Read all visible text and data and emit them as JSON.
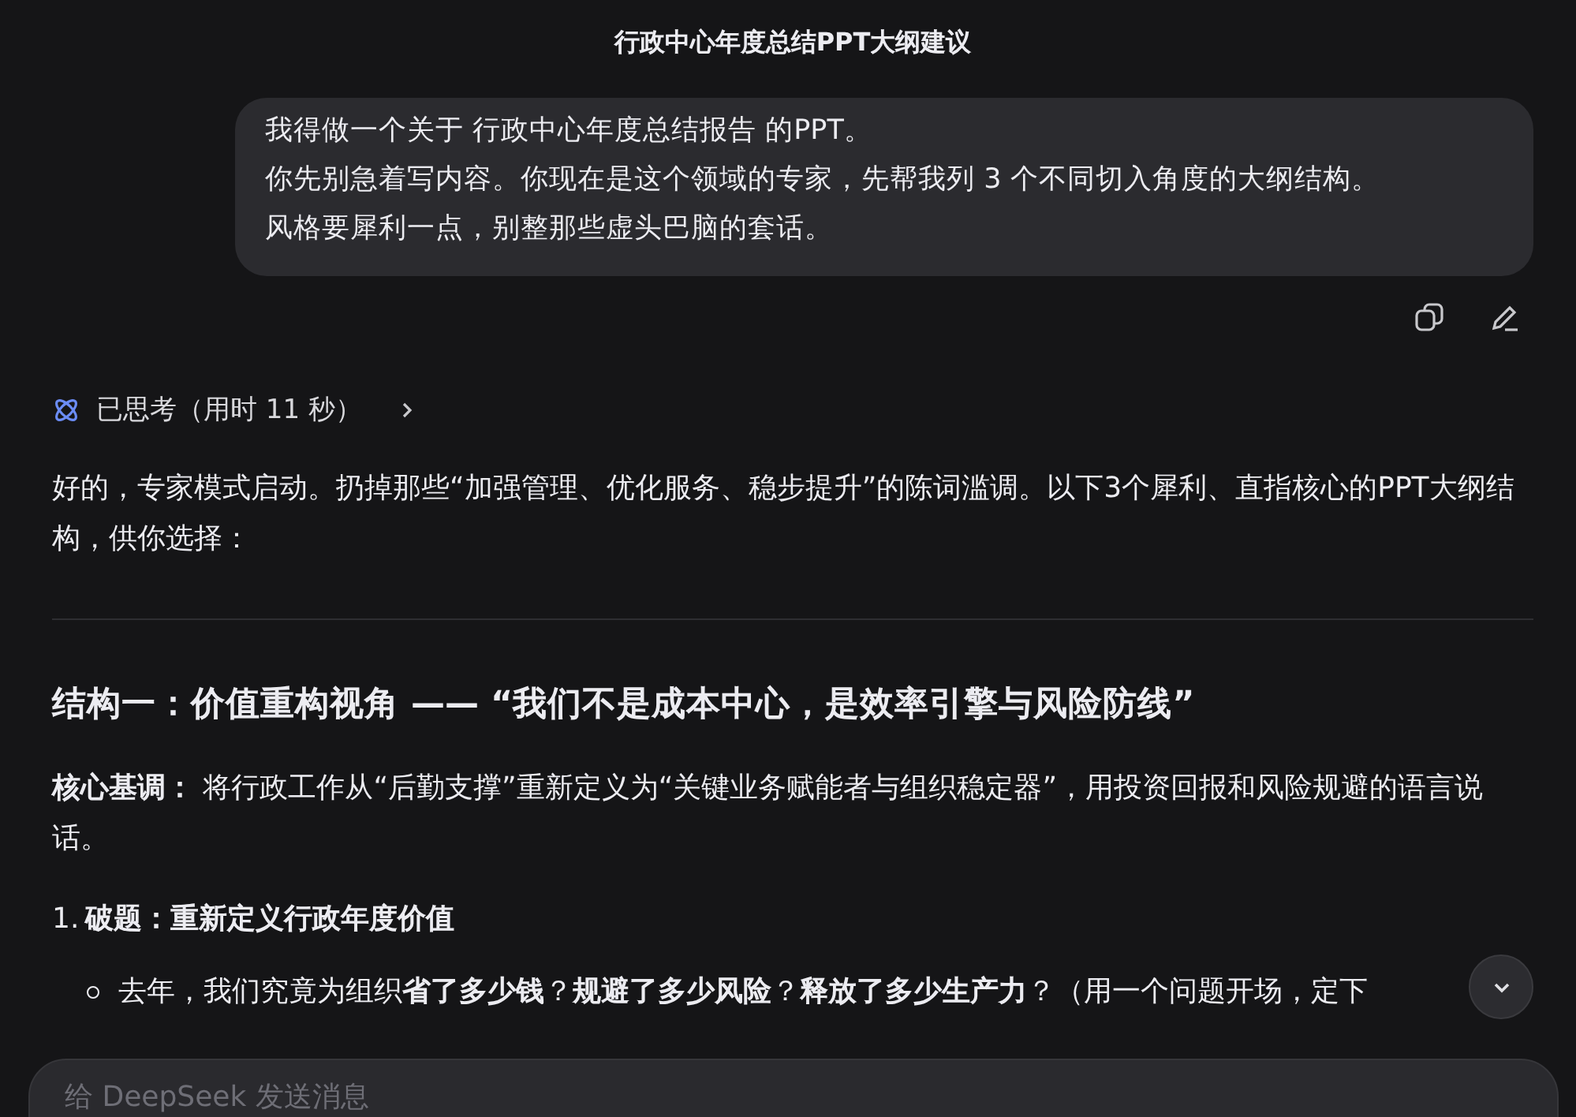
{
  "window": {
    "title": "行政中心年度总结PPT大纲建议"
  },
  "user_message": {
    "lines": [
      "我得做一个关于 行政中心年度总结报告 的PPT。",
      "你先别急着写内容。你现在是这个领域的专家，先帮我列 3 个不同切入角度的大纲结构。",
      "风格要犀利一点，别整那些虚头巴脑的套话。"
    ]
  },
  "thinking": {
    "label": "已思考（用时 11 秒）",
    "expanded": false
  },
  "reply": {
    "intro": "好的，专家模式启动。扔掉那些“加强管理、优化服务、稳步提升”的陈词滥调。以下3个犀利、直指核心的PPT大纲结构，供你选择：",
    "heading": "结构一：价值重构视角 —— “我们不是成本中心，是效率引擎与风险防线”",
    "core": "**核心基调：** 将行政工作从“后勤支撑”重新定义为“关键业务赋能者与组织稳定器”，用投资回报和风险规避的语言说话。",
    "items": [
      {
        "number": "1.",
        "title": "破题：重新定义行政年度价值",
        "bullets": [
          "去年，我们究竟为组织**省了多少钱**？**规避了多少风险**？**释放了多少生产力**？（用一个问题开场，定下"
        ]
      }
    ]
  },
  "composer": {
    "placeholder": "给 DeepSeek 发送消息"
  }
}
